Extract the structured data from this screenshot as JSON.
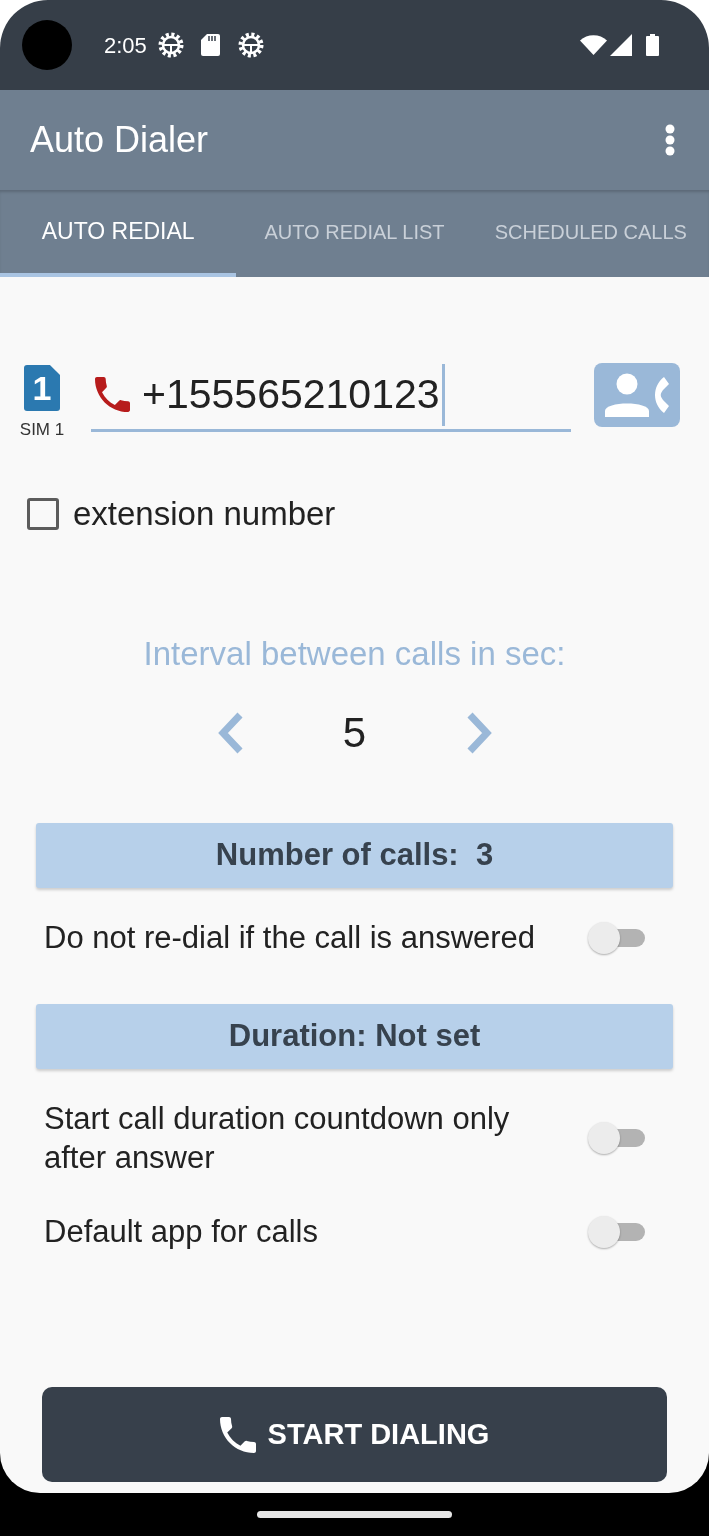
{
  "status_bar": {
    "time": "2:05"
  },
  "app_bar": {
    "title": "Auto Dialer"
  },
  "tabs": [
    {
      "label": "AUTO REDIAL",
      "selected": true
    },
    {
      "label": "AUTO REDIAL LIST",
      "selected": false
    },
    {
      "label": "SCHEDULED CALLS",
      "selected": false
    }
  ],
  "sim": {
    "number": "1",
    "label": "SIM 1"
  },
  "phone_field": {
    "value": "+155565210123"
  },
  "extension": {
    "label": "extension number",
    "checked": false
  },
  "interval": {
    "label": "Interval between calls in sec:",
    "value": "5"
  },
  "settings": [
    {
      "kind": "picker",
      "label": "Number of calls:  3"
    },
    {
      "kind": "switch",
      "label": "Do not re-dial if the call is answered",
      "on": false
    },
    {
      "kind": "picker",
      "label": "Duration: Not set"
    },
    {
      "kind": "switch",
      "label": "Start call duration countdown only after answer",
      "on": false
    },
    {
      "kind": "switch",
      "label": "Default app for calls",
      "on": false
    }
  ],
  "start_button": {
    "label": "START DIALING"
  }
}
